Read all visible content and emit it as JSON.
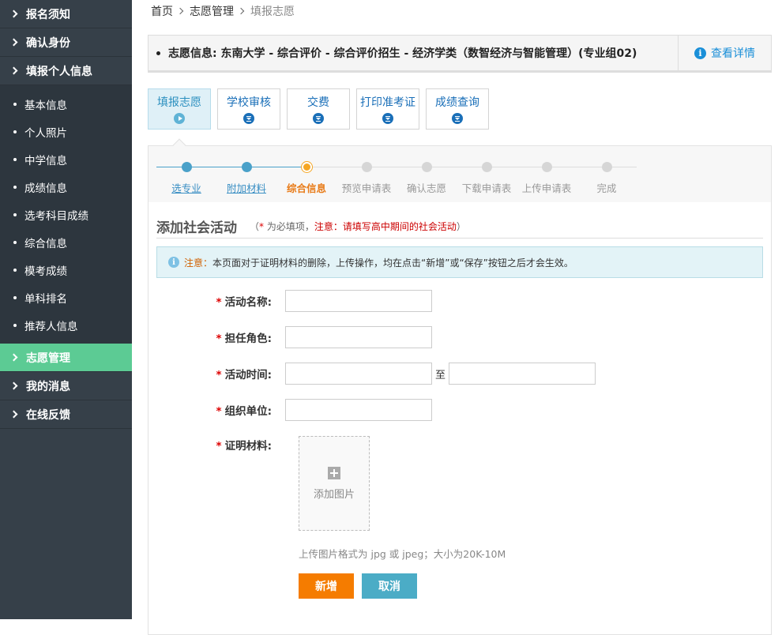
{
  "sidebar": {
    "top_items": [
      {
        "label": "报名须知"
      },
      {
        "label": "确认身份"
      },
      {
        "label": "填报个人信息"
      }
    ],
    "sub_items": [
      {
        "label": "基本信息"
      },
      {
        "label": "个人照片"
      },
      {
        "label": "中学信息"
      },
      {
        "label": "成绩信息"
      },
      {
        "label": "选考科目成绩"
      },
      {
        "label": "综合信息"
      },
      {
        "label": "模考成绩"
      },
      {
        "label": "单科排名"
      },
      {
        "label": "推荐人信息"
      }
    ],
    "bottom_items": [
      {
        "label": "志愿管理",
        "active": true
      },
      {
        "label": "我的消息"
      },
      {
        "label": "在线反馈"
      }
    ],
    "active_color": "#5ccb94"
  },
  "breadcrumb": {
    "items": [
      "首页",
      "志愿管理",
      "填报志愿"
    ]
  },
  "info_bar": {
    "text": "志愿信息:  东南大学 - 综合评价 - 综合评价招生 - 经济学类（数智经济与智能管理）(专业组02)",
    "detail_link": "查看详情"
  },
  "tabs": [
    {
      "label": "填报志愿",
      "active": true
    },
    {
      "label": "学校审核"
    },
    {
      "label": "交费"
    },
    {
      "label": "打印准考证"
    },
    {
      "label": "成绩查询"
    }
  ],
  "steps": [
    {
      "label": "选专业",
      "state": "done"
    },
    {
      "label": "附加材料",
      "state": "done"
    },
    {
      "label": "综合信息",
      "state": "current"
    },
    {
      "label": "预览申请表",
      "state": "todo"
    },
    {
      "label": "确认志愿",
      "state": "todo"
    },
    {
      "label": "下载申请表",
      "state": "todo"
    },
    {
      "label": "上传申请表",
      "state": "todo"
    },
    {
      "label": "完成",
      "state": "todo"
    }
  ],
  "section": {
    "title": "添加社会活动",
    "note_open": "（",
    "note_star": "*",
    "note_required": " 为必填项，",
    "note_warn": "注意：请填写高中期间的社会活动",
    "note_close": "）"
  },
  "notice": {
    "label": "注意：",
    "text": "本页面对于证明材料的删除，上传操作，均在点击“新增”或“保存”按钮之后才会生效。"
  },
  "form": {
    "required_mark": "*",
    "activity_name_label": "活动名称:",
    "role_label": "担任角色:",
    "time_label": "活动时间:",
    "time_to": "至",
    "org_label": "组织单位:",
    "proof_label": "证明材料:",
    "upload_label": "添加图片",
    "upload_hint": "上传图片格式为 jpg 或 jpeg；大小为20K-10M",
    "add_button": "新增",
    "cancel_button": "取消"
  }
}
